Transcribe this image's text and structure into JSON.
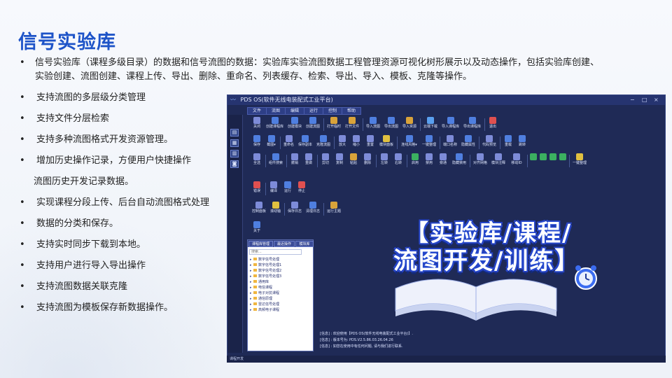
{
  "slide": {
    "title": "信号实验库",
    "intro": "信号实验库（课程多级目录）的数据和信号流图的数据：实验库实验流图数据工程管理资源可视化树形展示以及动态操作，包括实验库创建、实验创建、流图创建、课程上传、导出、删除、重命名、列表缓存、检索、导出、导入、模板、克隆等操作。",
    "bullets": [
      "支持流图的多层级分类管理",
      "支持文件分层检索",
      "支持多种流图格式开发资源管理。",
      "增加历史操作记录，方便用户快捷操作",
      "流图历史开发记录数据。",
      "实现课程分段上传、后台自动流图格式处理",
      "数据的分类和保存。",
      "支持实时同步下载到本地。",
      "支持用户进行导入导出操作",
      "支持流图数据关联克隆",
      "支持流图为模板保存新数据操作。"
    ],
    "bullet_flags": [
      true,
      true,
      true,
      true,
      false,
      true,
      true,
      true,
      true,
      true,
      true
    ],
    "bullet_char": "•",
    "colors": {
      "title": "#1e54c8",
      "window_bg": "#1f2a56",
      "accent": "#3b6cf0"
    }
  },
  "app": {
    "title": "PDS OS(软件无线电装配式工业平台)",
    "window_controls": [
      "−",
      "□",
      "×"
    ],
    "menu": [
      "文件",
      "流图",
      "编辑",
      "运行",
      "控制",
      "帮助"
    ],
    "sidebar_icons": [
      "folder-icon",
      "grid-icon",
      "table-icon",
      "camera-icon"
    ],
    "toolbar_rows": [
      [
        {
          "label": "关闭",
          "icon": "close-icon",
          "color": "#7d8bd8"
        },
        {
          "label": "创建课程库",
          "icon": "library-icon",
          "color": "#4f7fe0"
        },
        {
          "label": "创建模块",
          "icon": "module-icon",
          "color": "#4f7fe0"
        },
        {
          "label": "创建流图",
          "icon": "flow-icon",
          "color": "#4f7fe0"
        },
        {
          "sep": true
        },
        {
          "label": "打开临时",
          "icon": "open-icon",
          "color": "#d9a33a"
        },
        {
          "label": "打开文件",
          "icon": "file-icon",
          "color": "#d9a33a"
        },
        {
          "sep": true
        },
        {
          "label": "导入流图",
          "icon": "import-icon",
          "color": "#4f7fe0"
        },
        {
          "label": "导出流图",
          "icon": "export-icon",
          "color": "#4f7fe0"
        },
        {
          "label": "导入资源",
          "icon": "resource-icon",
          "color": "#d9a33a"
        },
        {
          "sep": true
        },
        {
          "label": "云端下载",
          "icon": "cloud-icon",
          "color": "#5aa0f0"
        },
        {
          "label": "导入课程库",
          "icon": "import-lib-icon",
          "color": "#4f7fe0"
        },
        {
          "label": "导出课程库",
          "icon": "export-lib-icon",
          "color": "#4f7fe0"
        },
        {
          "sep": true
        },
        {
          "label": "退出",
          "icon": "exit-icon",
          "color": "#e05050"
        }
      ],
      [
        {
          "label": "保存",
          "icon": "save-icon",
          "color": "#4f7fe0"
        },
        {
          "label": "截图▾",
          "icon": "screenshot-icon",
          "color": "#4f7fe0"
        },
        {
          "sep": true
        },
        {
          "label": "重命名",
          "icon": "rename-icon",
          "color": "#7d8bd8"
        },
        {
          "label": "保存副本",
          "icon": "copy-save-icon",
          "color": "#4f7fe0"
        },
        {
          "label": "克隆流图",
          "icon": "clone-icon",
          "color": "#4f7fe0"
        },
        {
          "sep": true
        },
        {
          "label": "放大",
          "icon": "zoom-in-icon",
          "color": "#7d8bd8"
        },
        {
          "label": "缩小",
          "icon": "zoom-out-icon",
          "color": "#7d8bd8"
        },
        {
          "label": "重置",
          "icon": "reset-icon",
          "color": "#7d8bd8"
        },
        {
          "label": "模块面板",
          "icon": "panel-icon",
          "color": "#e0c040"
        },
        {
          "sep": true
        },
        {
          "label": "连线风格▾",
          "icon": "link-style-icon",
          "color": "#4f7fe0"
        },
        {
          "label": "一键整理",
          "icon": "arrange-icon",
          "color": "#4f7fe0"
        },
        {
          "sep": true
        },
        {
          "label": "端口名称",
          "icon": "port-icon",
          "color": "#7d8bd8"
        },
        {
          "label": "隐藏属性",
          "icon": "hide-attr-icon",
          "color": "#4f7fe0"
        },
        {
          "sep": true
        },
        {
          "label": "代码预览",
          "icon": "code-icon",
          "color": "#7d8bd8"
        },
        {
          "sep": true
        },
        {
          "label": "重载",
          "icon": "reload-icon",
          "color": "#4f7fe0"
        },
        {
          "label": "跳转",
          "icon": "jump-icon",
          "color": "#4f7fe0"
        }
      ],
      [
        {
          "label": "全选",
          "icon": "select-all-icon",
          "color": "#7d8bd8"
        },
        {
          "sep": true
        },
        {
          "label": "组件搜索",
          "icon": "search-icon",
          "color": "#4f7fe0"
        },
        {
          "sep": true
        },
        {
          "label": "撤销",
          "icon": "undo-icon",
          "color": "#7d8bd8"
        },
        {
          "label": "重做",
          "icon": "redo-icon",
          "color": "#7d8bd8"
        },
        {
          "sep": true
        },
        {
          "label": "剪切",
          "icon": "cut-icon",
          "color": "#7d8bd8"
        },
        {
          "label": "复制",
          "icon": "copy-icon",
          "color": "#7d8bd8"
        },
        {
          "label": "粘贴",
          "icon": "paste-icon",
          "color": "#d9a33a"
        },
        {
          "label": "删除",
          "icon": "delete-icon",
          "color": "#7d8bd8"
        },
        {
          "sep": true
        },
        {
          "label": "左转",
          "icon": "rotate-left-icon",
          "color": "#7d8bd8"
        },
        {
          "label": "右转",
          "icon": "rotate-right-icon",
          "color": "#7d8bd8"
        },
        {
          "sep": true
        },
        {
          "label": "启用",
          "icon": "enable-icon",
          "color": "#3bb060"
        },
        {
          "label": "禁用",
          "icon": "disable-icon",
          "color": "#7d8bd8"
        },
        {
          "label": "旁通",
          "icon": "bypass-icon",
          "color": "#7d8bd8"
        },
        {
          "label": "隐藏禁用",
          "icon": "hide-disabled-icon",
          "color": "#4f7fe0"
        },
        {
          "sep": true
        },
        {
          "label": "对齐网格",
          "icon": "align-grid-icon",
          "color": "#7d8bd8"
        },
        {
          "label": "模块注释",
          "icon": "comment-icon",
          "color": "#7d8bd8"
        },
        {
          "label": "移动ID",
          "icon": "move-id-icon",
          "color": "#7d8bd8"
        },
        {
          "sep": true
        },
        {
          "label": "",
          "icon": "align-left-icon",
          "color": "#3bb060"
        },
        {
          "label": "",
          "icon": "align-center-icon",
          "color": "#3bb060"
        },
        {
          "label": "",
          "icon": "align-right-icon",
          "color": "#3bb060"
        },
        {
          "label": "",
          "icon": "align-top-icon",
          "color": "#3bb060"
        },
        {
          "sep": true
        },
        {
          "label": "一键整理",
          "icon": "arrange-icon",
          "color": "#e0c040"
        }
      ],
      [
        {
          "label": "错误",
          "icon": "error-icon",
          "color": "#e05050"
        },
        {
          "sep": true
        },
        {
          "label": "编译",
          "icon": "compile-icon",
          "color": "#7d8bd8"
        },
        {
          "label": "运行",
          "icon": "run-icon",
          "color": "#4f7fe0"
        },
        {
          "label": "停止",
          "icon": "stop-icon",
          "color": "#e05050"
        }
      ],
      [
        {
          "label": "控制面板",
          "icon": "control-panel-icon",
          "color": "#7d8bd8"
        },
        {
          "label": "滚动轴",
          "icon": "scroll-icon",
          "color": "#e0c040"
        },
        {
          "sep": true
        },
        {
          "label": "保存日志",
          "icon": "save-log-icon",
          "color": "#7d8bd8"
        },
        {
          "label": "清理日志",
          "icon": "clear-log-icon",
          "color": "#4f7fe0"
        },
        {
          "sep": true
        },
        {
          "label": "运行主题",
          "icon": "theme-icon",
          "color": "#d9a33a"
        }
      ],
      [
        {
          "label": "关于",
          "icon": "about-icon",
          "color": "#4f7fe0"
        }
      ]
    ],
    "tree": {
      "tabs": [
        "课程库管理",
        "最近操作",
        "模块库"
      ],
      "search_placeholder": "搜索...",
      "items": [
        {
          "label": "数字信号处理",
          "folder": true
        },
        {
          "label": "数字信号处理1",
          "folder": true
        },
        {
          "label": "数字信号处理2",
          "folder": true
        },
        {
          "label": "数字信号处理3",
          "folder": true
        },
        {
          "label": "通用库",
          "folder": true
        },
        {
          "label": "电信课程",
          "folder": true
        },
        {
          "label": "电子对抗课程",
          "folder": true
        },
        {
          "label": "通信原理",
          "folder": true
        },
        {
          "label": "雷达信号处理",
          "folder": true
        },
        {
          "label": "高频电子课程",
          "folder": true
        }
      ]
    },
    "banner": {
      "line1": "【实验库/课程/",
      "line2": "流图开发/训练】"
    },
    "log_lines": [
      "[信息] : 欢迎使用【PDS OS(软件无线电装配式工业平台)】.",
      "[信息] : 版本号为: PDS.V2.5.86.03.26.04.26",
      "[信息] : 如您在使用中有任何问题, 请与我们进行联系."
    ],
    "status": "课程开发"
  }
}
